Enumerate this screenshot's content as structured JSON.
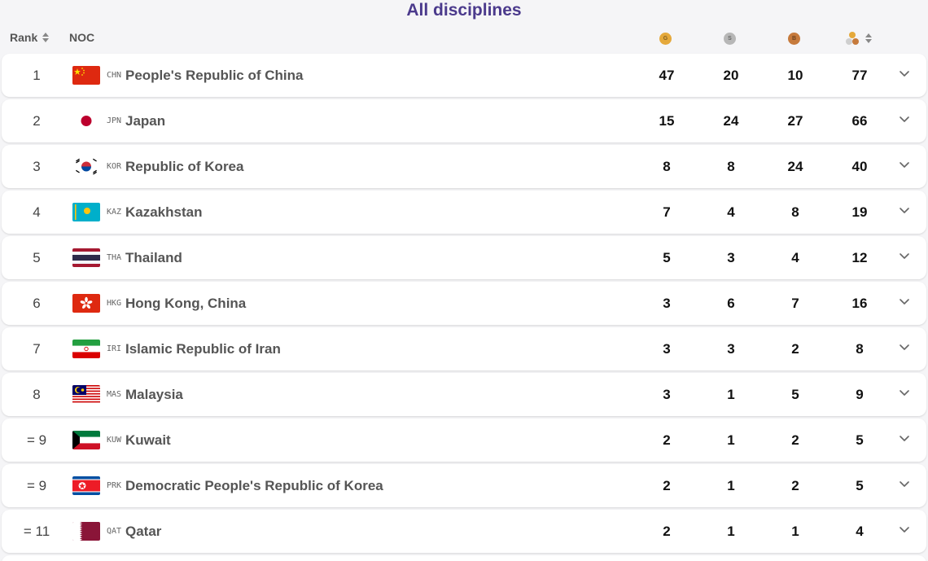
{
  "page": {
    "title": "All disciplines"
  },
  "header": {
    "rank_label": "Rank",
    "noc_label": "NOC",
    "gold_letter": "G",
    "silver_letter": "S",
    "bronze_letter": "B"
  },
  "colors": {
    "gold": "#e5a93b",
    "silver": "#b7b7b7",
    "bronze": "#c67a3c",
    "title": "#4b3a8c"
  },
  "rows": [
    {
      "rank": "1",
      "code": "CHN",
      "name": "People's Republic of China",
      "flag": "china-flag-icon",
      "gold": "47",
      "silver": "20",
      "bronze": "10",
      "total": "77"
    },
    {
      "rank": "2",
      "code": "JPN",
      "name": "Japan",
      "flag": "japan-flag-icon",
      "gold": "15",
      "silver": "24",
      "bronze": "27",
      "total": "66"
    },
    {
      "rank": "3",
      "code": "KOR",
      "name": "Republic of Korea",
      "flag": "korea-flag-icon",
      "gold": "8",
      "silver": "8",
      "bronze": "24",
      "total": "40"
    },
    {
      "rank": "4",
      "code": "KAZ",
      "name": "Kazakhstan",
      "flag": "kazakhstan-flag-icon",
      "gold": "7",
      "silver": "4",
      "bronze": "8",
      "total": "19"
    },
    {
      "rank": "5",
      "code": "THA",
      "name": "Thailand",
      "flag": "thailand-flag-icon",
      "gold": "5",
      "silver": "3",
      "bronze": "4",
      "total": "12"
    },
    {
      "rank": "6",
      "code": "HKG",
      "name": "Hong Kong, China",
      "flag": "hong-kong-flag-icon",
      "gold": "3",
      "silver": "6",
      "bronze": "7",
      "total": "16"
    },
    {
      "rank": "7",
      "code": "IRI",
      "name": "Islamic Republic of Iran",
      "flag": "iran-flag-icon",
      "gold": "3",
      "silver": "3",
      "bronze": "2",
      "total": "8"
    },
    {
      "rank": "8",
      "code": "MAS",
      "name": "Malaysia",
      "flag": "malaysia-flag-icon",
      "gold": "3",
      "silver": "1",
      "bronze": "5",
      "total": "9"
    },
    {
      "rank": "= 9",
      "code": "KUW",
      "name": "Kuwait",
      "flag": "kuwait-flag-icon",
      "gold": "2",
      "silver": "1",
      "bronze": "2",
      "total": "5"
    },
    {
      "rank": "= 9",
      "code": "PRK",
      "name": "Democratic People's Republic of Korea",
      "flag": "dprk-flag-icon",
      "gold": "2",
      "silver": "1",
      "bronze": "2",
      "total": "5"
    },
    {
      "rank": "= 11",
      "code": "QAT",
      "name": "Qatar",
      "flag": "qatar-flag-icon",
      "gold": "2",
      "silver": "1",
      "bronze": "1",
      "total": "4"
    }
  ]
}
